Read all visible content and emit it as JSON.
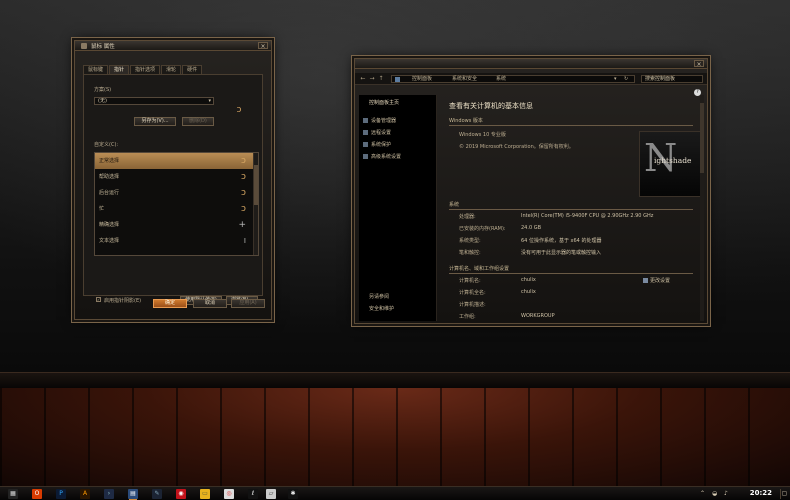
{
  "mouse_window": {
    "title": "鼠标 属性",
    "close": "×",
    "tabs": [
      "鼠标键",
      "指针",
      "指针选项",
      "滑轮",
      "硬件"
    ],
    "active_tab": "指针",
    "scheme_label": "方案(S)",
    "scheme_value": "(无)",
    "save_as": "另存为(V)...",
    "delete": "删除(D)",
    "customize_label": "自定义(C):",
    "pointers": [
      "正常选择",
      "帮助选择",
      "后台运行",
      "忙",
      "精确选择",
      "文本选择"
    ],
    "selected_pointer": "正常选择",
    "shadow_checkbox": "启用指针阴影(E)",
    "use_default": "使用默认值(F)",
    "browse": "浏览(B)...",
    "ok": "确定",
    "cancel": "取消",
    "apply": "应用(A)"
  },
  "system_window": {
    "breadcrumb": [
      "控制面板",
      "系统和安全",
      "系统"
    ],
    "search_placeholder": "搜索控制面板",
    "nav_home": "控制面板主页",
    "nav_items": [
      "设备管理器",
      "远程设置",
      "系统保护",
      "高级系统设置"
    ],
    "see_also": [
      "另请参阅",
      "安全和维护"
    ],
    "heading": "查看有关计算机的基本信息",
    "edition_section": "Windows 版本",
    "edition": "Windows 10 专业版",
    "copyright": "© 2019 Microsoft Corporation。保留所有权利。",
    "logo_text": "ightshade",
    "logo_initial": "N",
    "system_section": "系统",
    "system_rows": [
      {
        "k": "处理器:",
        "v": "Intel(R) Core(TM) i5-9400F CPU @ 2.90GHz   2.90 GHz"
      },
      {
        "k": "已安装的内存(RAM):",
        "v": "24.0 GB"
      },
      {
        "k": "系统类型:",
        "v": "64 位操作系统，基于 x64 的处理器"
      },
      {
        "k": "笔和触控:",
        "v": "没有可用于此显示器的笔或触控输入"
      }
    ],
    "computer_section": "计算机名、域和工作组设置",
    "computer_rows": [
      {
        "k": "计算机名:",
        "v": "chulix"
      },
      {
        "k": "计算机全名:",
        "v": "chulix"
      },
      {
        "k": "计算机描述:",
        "v": ""
      },
      {
        "k": "工作组:",
        "v": "WORKGROUP"
      }
    ],
    "change_settings": "更改设置"
  },
  "taskbar": {
    "clock": "20:22",
    "apps": [
      "office",
      "photoshop",
      "illustrator",
      "terminal",
      "clipboard",
      "pen",
      "netease",
      "folder",
      "chrome",
      "text",
      "drive",
      "settings"
    ]
  },
  "colors": {
    "accent": "#d07a2e",
    "selection": "#b98d55",
    "frame": "#7a6449"
  }
}
